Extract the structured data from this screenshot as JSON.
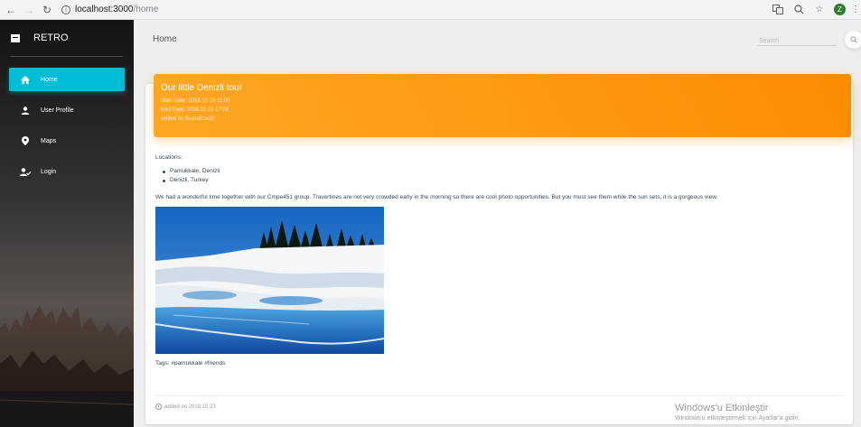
{
  "browser": {
    "url_host": "localhost:3000",
    "url_path": "/home",
    "profile_initial": "Z"
  },
  "sidebar": {
    "brand": "RETRO",
    "items": [
      {
        "label": "Home",
        "icon": "home-icon",
        "active": true
      },
      {
        "label": "User Profile",
        "icon": "person-icon",
        "active": false
      },
      {
        "label": "Maps",
        "icon": "location-pin-icon",
        "active": false
      },
      {
        "label": "Login",
        "icon": "person-check-icon",
        "active": false
      }
    ],
    "active_color": "#00bcd4"
  },
  "header": {
    "title": "Home",
    "search_placeholder": "Search"
  },
  "post": {
    "title": "Our little Denizli tour",
    "start_date": "Start Date: 2018.10.19 11:00",
    "end_date": "End Date: 2018.10.19 17:00",
    "added_by": "Added by BusraEce20",
    "locations_label": "Locations:",
    "locations": [
      "Pamukkale, Denizli",
      "Denizli, Turkey"
    ],
    "description": "We had a wonderful time together with our Cmpe451 group. Travertines are not very crowded early in the morning so there are cool photo opportunities. But you must see them while the sun sets, it is a gorgeous view.",
    "tags": "Tags: #pamukkale #friends",
    "added_on": "added on 2018.10.23",
    "header_color": "#fb8c00"
  },
  "watermark": {
    "title": "Windows'u Etkinleştir",
    "subtitle": "Windows'u etkinleştirmek için Ayarlar'a gidin."
  }
}
